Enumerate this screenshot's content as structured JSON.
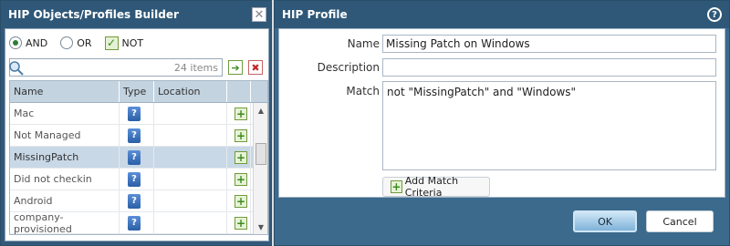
{
  "left_dialog": {
    "title": "HIP Objects/Profiles Builder",
    "close_symbol": "✕",
    "operators": {
      "and": "AND",
      "or": "OR",
      "not": "NOT"
    },
    "search": {
      "count": "24 items",
      "placeholder": ""
    },
    "columns": [
      "Name",
      "Type",
      "Location"
    ],
    "rows": [
      {
        "name": "Mac"
      },
      {
        "name": "Not Managed"
      },
      {
        "name": "MissingPatch"
      },
      {
        "name": "Did not checkin"
      },
      {
        "name": "Android"
      },
      {
        "name": "company-provisioned"
      }
    ]
  },
  "right_dialog": {
    "title": "HIP Profile",
    "help_symbol": "?",
    "name_label": "Name",
    "name_value": "Missing Patch on Windows",
    "description_label": "Description",
    "description_value": "",
    "match_label": "Match",
    "match_value": "not \"MissingPatch\" and \"Windows\"",
    "add_match_label": "Add Match Criteria",
    "ok_label": "OK",
    "cancel_label": "Cancel"
  },
  "icons": {
    "type_icon": "hip-object-icon",
    "add_icon": "add-plus-icon",
    "go_icon": "arrow-go-icon",
    "clear_icon": "clear-x-icon"
  },
  "colors": {
    "titlebar": "#2f5878",
    "selected_row": "#c9d8e6",
    "accent_green": "#3b8b1e"
  }
}
